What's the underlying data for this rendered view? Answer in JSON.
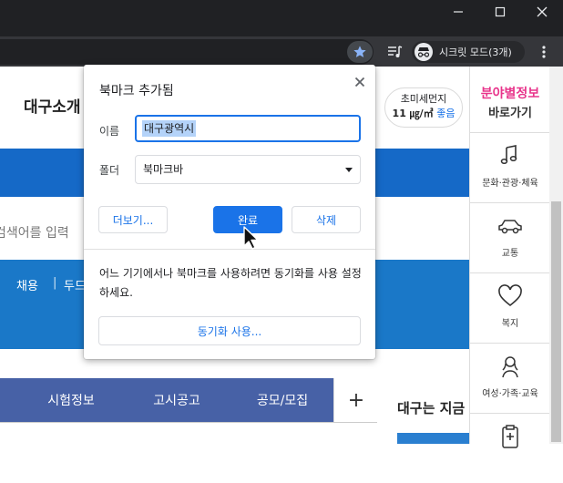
{
  "browser": {
    "incognito_label": "시크릿 모드(3개)"
  },
  "page": {
    "site_title": "대구소개",
    "dust": {
      "label": "초미세먼지",
      "value": "11 ㎍/㎥",
      "grade": "좋음"
    },
    "search_hint": "검색어를 입력",
    "nav_items": [
      "채용",
      "두드"
    ],
    "tabs": [
      "시험정보",
      "고시공고",
      "공모/모집",
      "+"
    ],
    "daegu_now": "대구는 지금"
  },
  "quick_menu": {
    "title": "분야별정보",
    "subtitle": "바로가기",
    "items": [
      {
        "label": "문화·관광·체육",
        "icon": "music-note-icon"
      },
      {
        "label": "교통",
        "icon": "car-icon"
      },
      {
        "label": "복지",
        "icon": "heart-icon"
      },
      {
        "label": "여성·가족·교육",
        "icon": "woman-icon"
      },
      {
        "label": "",
        "icon": "medical-clipboard-icon"
      }
    ]
  },
  "bookmark_dialog": {
    "title": "북마크 추가됨",
    "name_label": "이름",
    "name_value": "대구광역시",
    "folder_label": "폴더",
    "folder_value": "북마크바",
    "more_button": "더보기...",
    "done_button": "완료",
    "delete_button": "삭제",
    "sync_text": "어느 기기에서나 북마크를 사용하려면 동기화를 사용 설정하세요.",
    "sync_button": "동기화 사용..."
  },
  "colors": {
    "chrome_dark": "#202124",
    "accent_blue": "#1a73e8",
    "site_blue": "#1569c7",
    "tab_blue": "#4761a6",
    "quick_pink": "#e8348b"
  }
}
